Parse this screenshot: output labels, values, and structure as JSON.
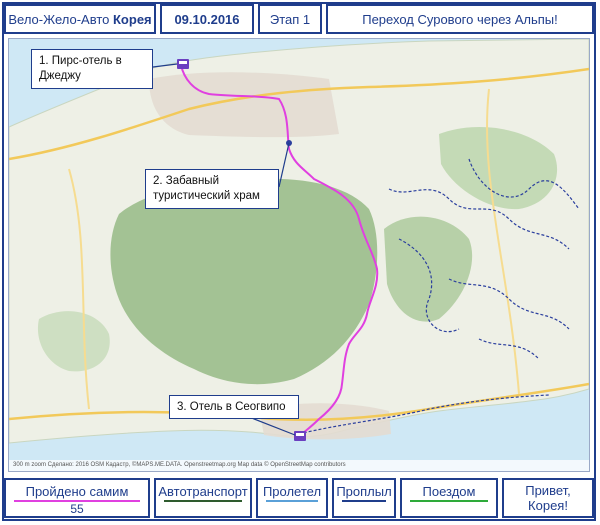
{
  "header": {
    "title_prefix": "Вело-Жело-Авто",
    "title_country": "Корея",
    "date": "09.10.2016",
    "stage": "Этап 1",
    "route_title": "Переход Сурового через Альпы!"
  },
  "map": {
    "callouts": [
      {
        "id": 1,
        "text": "1. Пирс-отель в Джеджу"
      },
      {
        "id": 2,
        "text": "2. Забавный туристический храм"
      },
      {
        "id": 3,
        "text": "3. Отель в Сеогвипо"
      }
    ],
    "attribution": "300 m zoom   Сделано: 2016 OSM Кадастр, ©MAPS.ME.DATA. Openstreetmap.org  Map data © OpenStreetMap contributors",
    "colors": {
      "route": "#e040e0",
      "bus_routes": "#2b3f9e",
      "sea": "#cfe8f5",
      "land": "#eef0e6",
      "forest": "#8fb67e"
    }
  },
  "legend": {
    "walked": {
      "label": "Пройдено самим",
      "value": "55",
      "color": "#e040e0"
    },
    "auto": {
      "label": "Автотранспорт",
      "color": "#2e5b2e"
    },
    "flown": {
      "label": "Пролетел",
      "color": "#5aa0d8"
    },
    "sailed": {
      "label": "Проплыл",
      "color": "#1f3d8c"
    },
    "train": {
      "label": "Поездом",
      "color": "#2eaa3a"
    },
    "greeting": "Привет, Корея!"
  }
}
